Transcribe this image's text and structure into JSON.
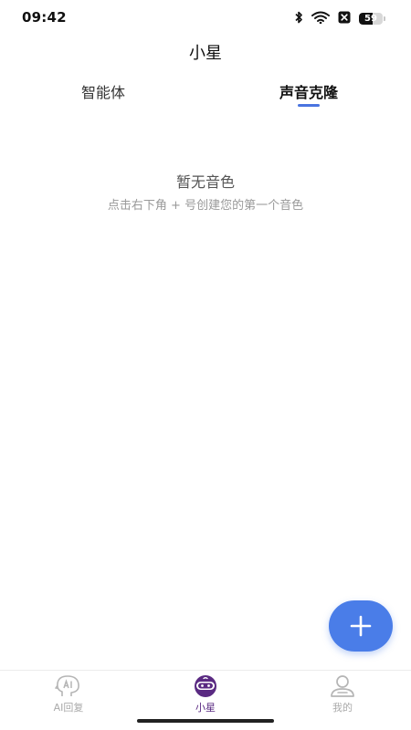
{
  "status_bar": {
    "time": "09:42",
    "battery_level": "59",
    "battery_fraction": 0.59,
    "icons": [
      "bluetooth-icon",
      "wifi-icon",
      "sim-blocked-icon",
      "battery-icon"
    ]
  },
  "header": {
    "title": "小星"
  },
  "tabs": [
    {
      "label": "智能体",
      "active": false
    },
    {
      "label": "声音克隆",
      "active": true
    }
  ],
  "empty_state": {
    "title": "暂无音色",
    "hint": "点击右下角 + 号创建您的第一个音色"
  },
  "fab": {
    "icon": "plus-icon"
  },
  "bottom_nav": {
    "items": [
      {
        "label": "AI回复",
        "icon": "ai-head-icon",
        "active": false
      },
      {
        "label": "小星",
        "icon": "robot-icon",
        "active": true
      },
      {
        "label": "我的",
        "icon": "person-icon",
        "active": false
      }
    ]
  },
  "colors": {
    "accent": "#4a7de8",
    "tab_indicator": "#4a74e0",
    "nav_active": "#5a2a82",
    "nav_inactive": "#aaaaaa"
  }
}
